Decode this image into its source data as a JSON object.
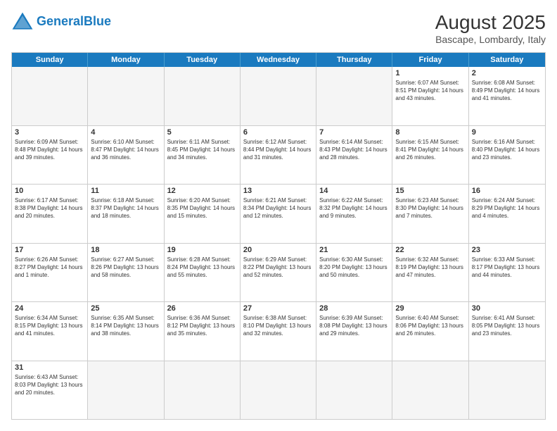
{
  "logo": {
    "text_general": "General",
    "text_blue": "Blue"
  },
  "title": "August 2025",
  "subtitle": "Bascape, Lombardy, Italy",
  "header_days": [
    "Sunday",
    "Monday",
    "Tuesday",
    "Wednesday",
    "Thursday",
    "Friday",
    "Saturday"
  ],
  "weeks": [
    [
      {
        "day": "",
        "info": "",
        "empty": true
      },
      {
        "day": "",
        "info": "",
        "empty": true
      },
      {
        "day": "",
        "info": "",
        "empty": true
      },
      {
        "day": "",
        "info": "",
        "empty": true
      },
      {
        "day": "",
        "info": "",
        "empty": true
      },
      {
        "day": "1",
        "info": "Sunrise: 6:07 AM\nSunset: 8:51 PM\nDaylight: 14 hours and 43 minutes."
      },
      {
        "day": "2",
        "info": "Sunrise: 6:08 AM\nSunset: 8:49 PM\nDaylight: 14 hours and 41 minutes."
      }
    ],
    [
      {
        "day": "3",
        "info": "Sunrise: 6:09 AM\nSunset: 8:48 PM\nDaylight: 14 hours and 39 minutes."
      },
      {
        "day": "4",
        "info": "Sunrise: 6:10 AM\nSunset: 8:47 PM\nDaylight: 14 hours and 36 minutes."
      },
      {
        "day": "5",
        "info": "Sunrise: 6:11 AM\nSunset: 8:45 PM\nDaylight: 14 hours and 34 minutes."
      },
      {
        "day": "6",
        "info": "Sunrise: 6:12 AM\nSunset: 8:44 PM\nDaylight: 14 hours and 31 minutes."
      },
      {
        "day": "7",
        "info": "Sunrise: 6:14 AM\nSunset: 8:43 PM\nDaylight: 14 hours and 28 minutes."
      },
      {
        "day": "8",
        "info": "Sunrise: 6:15 AM\nSunset: 8:41 PM\nDaylight: 14 hours and 26 minutes."
      },
      {
        "day": "9",
        "info": "Sunrise: 6:16 AM\nSunset: 8:40 PM\nDaylight: 14 hours and 23 minutes."
      }
    ],
    [
      {
        "day": "10",
        "info": "Sunrise: 6:17 AM\nSunset: 8:38 PM\nDaylight: 14 hours and 20 minutes."
      },
      {
        "day": "11",
        "info": "Sunrise: 6:18 AM\nSunset: 8:37 PM\nDaylight: 14 hours and 18 minutes."
      },
      {
        "day": "12",
        "info": "Sunrise: 6:20 AM\nSunset: 8:35 PM\nDaylight: 14 hours and 15 minutes."
      },
      {
        "day": "13",
        "info": "Sunrise: 6:21 AM\nSunset: 8:34 PM\nDaylight: 14 hours and 12 minutes."
      },
      {
        "day": "14",
        "info": "Sunrise: 6:22 AM\nSunset: 8:32 PM\nDaylight: 14 hours and 9 minutes."
      },
      {
        "day": "15",
        "info": "Sunrise: 6:23 AM\nSunset: 8:30 PM\nDaylight: 14 hours and 7 minutes."
      },
      {
        "day": "16",
        "info": "Sunrise: 6:24 AM\nSunset: 8:29 PM\nDaylight: 14 hours and 4 minutes."
      }
    ],
    [
      {
        "day": "17",
        "info": "Sunrise: 6:26 AM\nSunset: 8:27 PM\nDaylight: 14 hours and 1 minute."
      },
      {
        "day": "18",
        "info": "Sunrise: 6:27 AM\nSunset: 8:26 PM\nDaylight: 13 hours and 58 minutes."
      },
      {
        "day": "19",
        "info": "Sunrise: 6:28 AM\nSunset: 8:24 PM\nDaylight: 13 hours and 55 minutes."
      },
      {
        "day": "20",
        "info": "Sunrise: 6:29 AM\nSunset: 8:22 PM\nDaylight: 13 hours and 52 minutes."
      },
      {
        "day": "21",
        "info": "Sunrise: 6:30 AM\nSunset: 8:20 PM\nDaylight: 13 hours and 50 minutes."
      },
      {
        "day": "22",
        "info": "Sunrise: 6:32 AM\nSunset: 8:19 PM\nDaylight: 13 hours and 47 minutes."
      },
      {
        "day": "23",
        "info": "Sunrise: 6:33 AM\nSunset: 8:17 PM\nDaylight: 13 hours and 44 minutes."
      }
    ],
    [
      {
        "day": "24",
        "info": "Sunrise: 6:34 AM\nSunset: 8:15 PM\nDaylight: 13 hours and 41 minutes."
      },
      {
        "day": "25",
        "info": "Sunrise: 6:35 AM\nSunset: 8:14 PM\nDaylight: 13 hours and 38 minutes."
      },
      {
        "day": "26",
        "info": "Sunrise: 6:36 AM\nSunset: 8:12 PM\nDaylight: 13 hours and 35 minutes."
      },
      {
        "day": "27",
        "info": "Sunrise: 6:38 AM\nSunset: 8:10 PM\nDaylight: 13 hours and 32 minutes."
      },
      {
        "day": "28",
        "info": "Sunrise: 6:39 AM\nSunset: 8:08 PM\nDaylight: 13 hours and 29 minutes."
      },
      {
        "day": "29",
        "info": "Sunrise: 6:40 AM\nSunset: 8:06 PM\nDaylight: 13 hours and 26 minutes."
      },
      {
        "day": "30",
        "info": "Sunrise: 6:41 AM\nSunset: 8:05 PM\nDaylight: 13 hours and 23 minutes."
      }
    ],
    [
      {
        "day": "31",
        "info": "Sunrise: 6:43 AM\nSunset: 8:03 PM\nDaylight: 13 hours and 20 minutes."
      },
      {
        "day": "",
        "info": "",
        "empty": true
      },
      {
        "day": "",
        "info": "",
        "empty": true
      },
      {
        "day": "",
        "info": "",
        "empty": true
      },
      {
        "day": "",
        "info": "",
        "empty": true
      },
      {
        "day": "",
        "info": "",
        "empty": true
      },
      {
        "day": "",
        "info": "",
        "empty": true
      }
    ]
  ]
}
